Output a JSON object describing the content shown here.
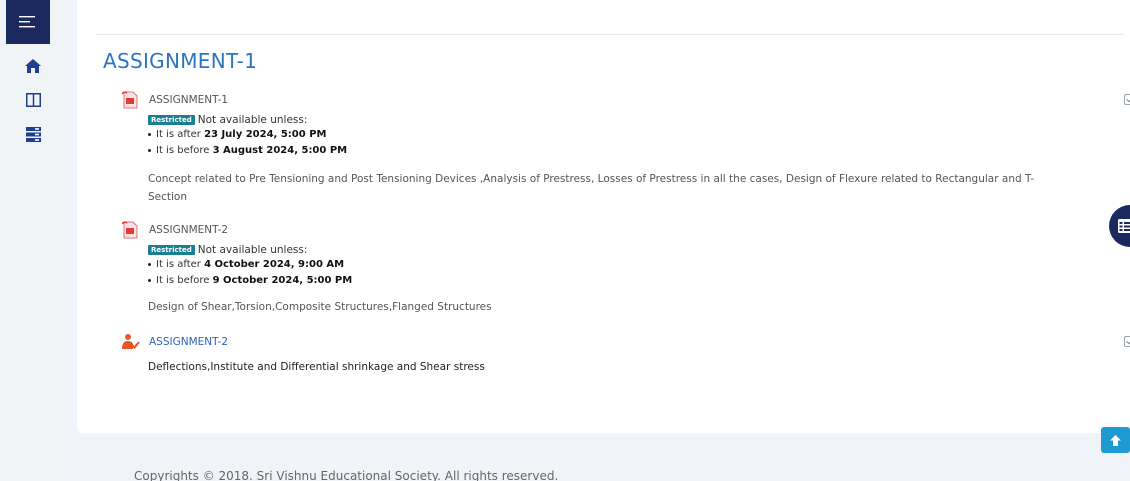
{
  "colors": {
    "sidebar_toggle": "#1a2a5e",
    "title": "#2a76c2",
    "badge": "#1b7f93",
    "scroll_top": "#1e9ad3"
  },
  "sidebar": {
    "toggle_icon": "hamburger-menu-icon",
    "items": [
      {
        "icon": "home-icon"
      },
      {
        "icon": "columns-icon"
      },
      {
        "icon": "list-icon"
      }
    ]
  },
  "section": {
    "title": "ASSIGNMENT-1"
  },
  "activities": [
    {
      "icon": "pdf-file-icon",
      "name": "ASSIGNMENT-1",
      "badge": "Restricted",
      "restriction_text": "Not available unless:",
      "conditions": [
        {
          "prefix": "It is after ",
          "date": "23 July 2024, 5:00 PM"
        },
        {
          "prefix": "It is before ",
          "date": "3 August 2024, 5:00 PM"
        }
      ],
      "description": "Concept related to Pre Tensioning and Post Tensioning Devices ,Analysis of Prestress, Losses of Prestress in all the cases, Design of Flexure related to Rectangular and T-Section"
    },
    {
      "icon": "pdf-file-icon",
      "name": "ASSIGNMENT-2",
      "badge": "Restricted",
      "restriction_text": "Not available unless:",
      "conditions": [
        {
          "prefix": "It is after ",
          "date": "4 October 2024, 9:00 AM"
        },
        {
          "prefix": "It is before ",
          "date": "9 October 2024, 5:00 PM"
        }
      ],
      "description": "Design of Shear,Torsion,Composite Structures,Flanged Structures"
    },
    {
      "icon": "assignment-icon",
      "name": "ASSIGNMENT-2",
      "description": "Deflections,Institute and Differential shrinkage and Shear stress"
    }
  ],
  "footer": {
    "text": "Copyrights © 2018. Sri Vishnu Educational Society. All rights reserved."
  }
}
